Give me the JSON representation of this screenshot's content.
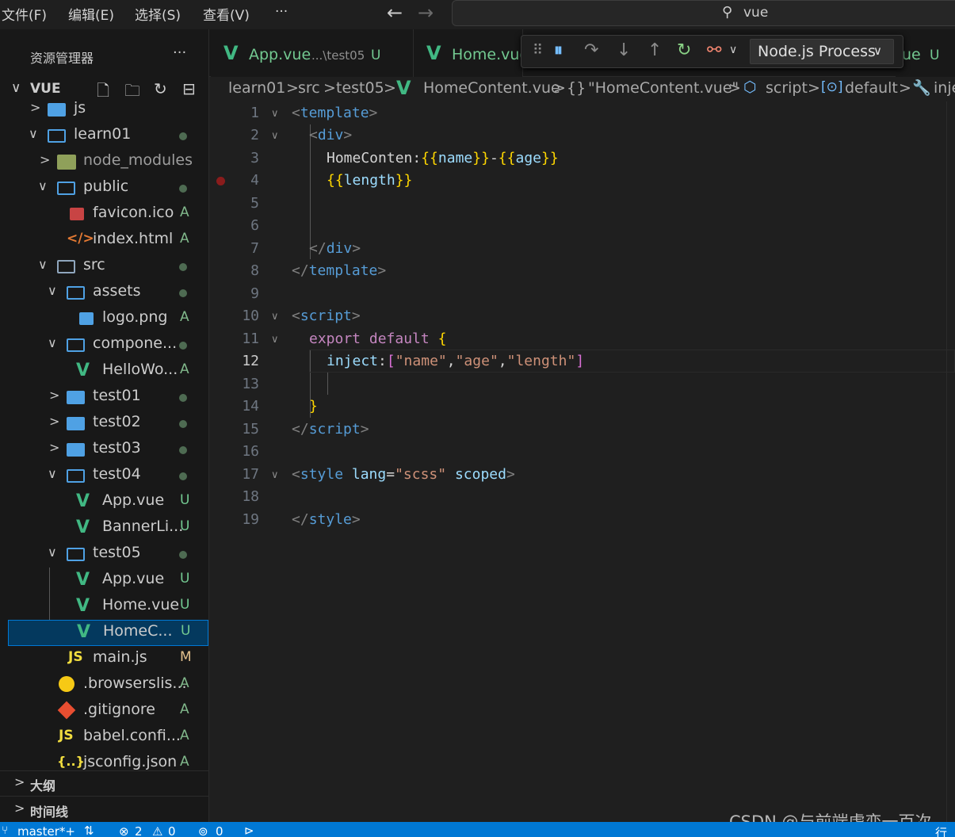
{
  "menu": {
    "file": "文件(F)",
    "edit": "编辑(E)",
    "selection": "选择(S)",
    "view": "查看(V)",
    "more": "···"
  },
  "search": {
    "value": "vue"
  },
  "sidebar": {
    "title": "资源管理器",
    "more": "···",
    "root": "VUE",
    "items": [
      {
        "label": "js"
      },
      {
        "label": "learn01"
      },
      {
        "label": "node_modules"
      },
      {
        "label": "public"
      },
      {
        "label": "favicon.ico",
        "badge": "A"
      },
      {
        "label": "index.html",
        "badge": "A"
      },
      {
        "label": "src"
      },
      {
        "label": "assets"
      },
      {
        "label": "logo.png",
        "badge": "A"
      },
      {
        "label": "compone..."
      },
      {
        "label": "HelloWo...",
        "badge": "A"
      },
      {
        "label": "test01"
      },
      {
        "label": "test02"
      },
      {
        "label": "test03"
      },
      {
        "label": "test04"
      },
      {
        "label": "App.vue",
        "badge": "U"
      },
      {
        "label": "BannerLi...",
        "badge": "U"
      },
      {
        "label": "test05"
      },
      {
        "label": "App.vue",
        "badge": "U"
      },
      {
        "label": "Home.vue",
        "badge": "U"
      },
      {
        "label": "HomeC...",
        "badge": "U"
      },
      {
        "label": "main.js",
        "badge": "M"
      },
      {
        "label": ".browserslis...",
        "badge": "A"
      },
      {
        "label": ".gitignore",
        "badge": "A"
      },
      {
        "label": "babel.confi...",
        "badge": "A"
      },
      {
        "label": "jsconfig.json",
        "badge": "A"
      }
    ],
    "outline": "大纲",
    "timeline": "时间线"
  },
  "tabs": [
    {
      "label": "App.vue",
      "path": "...\\test05",
      "badge": "U"
    },
    {
      "label": "Home.vue"
    },
    {
      "label_tail": "ue",
      "badge": "U"
    }
  ],
  "debug": {
    "target": "Node.js Process"
  },
  "breadcrumb": {
    "p1": "learn01",
    "p2": "src",
    "p3": "test05",
    "p4": "HomeContent.vue",
    "p5": "\"HomeContent.vue\"",
    "p6": "script",
    "p7": "default",
    "p8": "inje"
  },
  "code": {
    "line_numbers": [
      "1",
      "2",
      "3",
      "4",
      "5",
      "6",
      "7",
      "8",
      "9",
      "10",
      "11",
      "12",
      "13",
      "14",
      "15",
      "16",
      "17",
      "18",
      "19"
    ],
    "l1_tag": "template",
    "l2_tag": "div",
    "l3_text": "HomeConten:",
    "l3_v1": "name",
    "l3_dash": "-",
    "l3_v2": "age",
    "l4_v": "length",
    "l7_tag": "div",
    "l8_tag": "template",
    "l10_tag": "script",
    "l11_kw1": "export",
    "l11_kw2": "default",
    "l12_key": "inject",
    "l12_s1": "\"name\"",
    "l12_s2": "\"age\"",
    "l12_s3": "\"length\"",
    "l15_tag": "script",
    "l17_tag": "style",
    "l17_attr1": "lang",
    "l17_val": "\"scss\"",
    "l17_attr2": "scoped",
    "l19_tag": "style"
  },
  "status": {
    "branch": "master*+",
    "errors": "2",
    "warnings": "0",
    "ports": "0",
    "line": "行"
  },
  "watermark": "CSDN @与前端虐恋一百次"
}
